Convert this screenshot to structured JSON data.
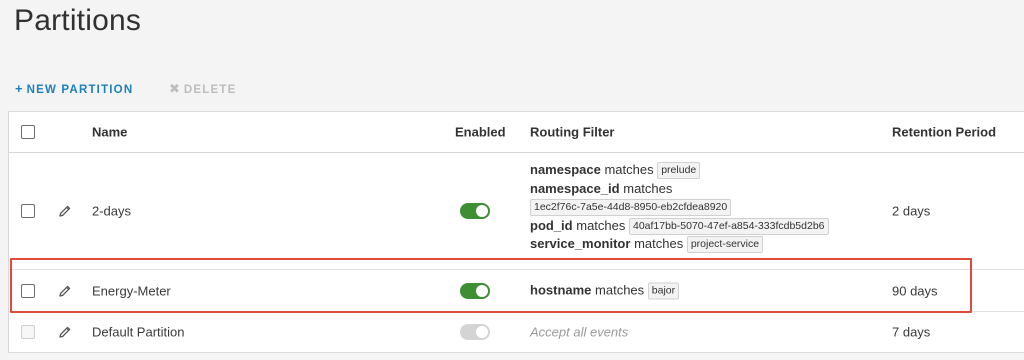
{
  "page": {
    "title": "Partitions"
  },
  "actions": {
    "new_label": "NEW PARTITION",
    "new_glyph": "+",
    "delete_label": "DELETE",
    "delete_glyph": "✖"
  },
  "table": {
    "headers": {
      "name": "Name",
      "enabled": "Enabled",
      "routing_filter": "Routing Filter",
      "retention": "Retention Period"
    },
    "rows": [
      {
        "name": "2-days",
        "enabled": true,
        "retention": "2 days",
        "filters": [
          {
            "key": "namespace",
            "op": "matches",
            "value": "prelude"
          },
          {
            "key": "namespace_id",
            "op": "matches",
            "value": "1ec2f76c-7a5e-44d8-8950-eb2cfdea8920"
          },
          {
            "key": "pod_id",
            "op": "matches",
            "value": "40af17bb-5070-47ef-a854-333fcdb5d2b6"
          },
          {
            "key": "service_monitor",
            "op": "matches",
            "value": "project-service"
          }
        ]
      },
      {
        "name": "Energy-Meter",
        "enabled": true,
        "retention": "90 days",
        "filters": [
          {
            "key": "hostname",
            "op": "matches",
            "value": "bajor"
          }
        ]
      },
      {
        "name": "Default Partition",
        "enabled": true,
        "toggle_disabled": true,
        "checkbox_disabled": true,
        "retention": "7 days",
        "filter_text": "Accept all events"
      }
    ]
  },
  "colors": {
    "accent": "#1e7fba",
    "toggle_on": "#3e8e34",
    "toggle_disabled": "#d4d4d4",
    "highlight": "#e04a39"
  }
}
